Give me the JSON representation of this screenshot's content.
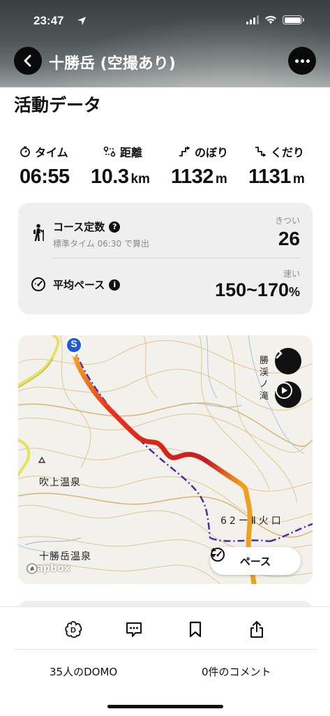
{
  "status_bar": {
    "time": "23:47"
  },
  "header": {
    "title": "十勝岳 (空撮あり)",
    "back_icon": "chevron-left-icon",
    "more_icon": "ellipsis-icon"
  },
  "section": {
    "title": "活動データ"
  },
  "stats": [
    {
      "icon": "stopwatch-icon",
      "label": "タイム",
      "value": "06:55",
      "unit": ""
    },
    {
      "icon": "route-icon",
      "label": "距離",
      "value": "10.3",
      "unit": "km"
    },
    {
      "icon": "ascent-icon",
      "label": "のぼり",
      "value": "1132",
      "unit": "m"
    },
    {
      "icon": "descent-icon",
      "label": "くだり",
      "value": "1131",
      "unit": "m"
    }
  ],
  "course": {
    "label": "コース定数",
    "info_icon": "help-icon",
    "sub": "標準タイム 06:30 で算出",
    "caption": "きつい",
    "value": "26"
  },
  "pace": {
    "label": "平均ペース",
    "info_icon": "info-icon",
    "caption": "速い",
    "value": "150~170",
    "unit": "%"
  },
  "map": {
    "start_marker": "S",
    "labels": {
      "fukiage": "吹上温泉",
      "tokachidake_onsen": "十勝岳温泉",
      "crater": "62ーⅡ火口",
      "waterfall": "勝　渓　ノ　滝"
    },
    "attribution": "mapbox",
    "pace_toggle": "ペース",
    "colors": {
      "route_start": "#f5a623",
      "route_mid": "#e8341c",
      "route_end": "#7a1230",
      "trail": "#4a2aa8"
    }
  },
  "footer": {
    "domo_count": "35人のDOMO",
    "comment_count": "0件のコメント"
  }
}
